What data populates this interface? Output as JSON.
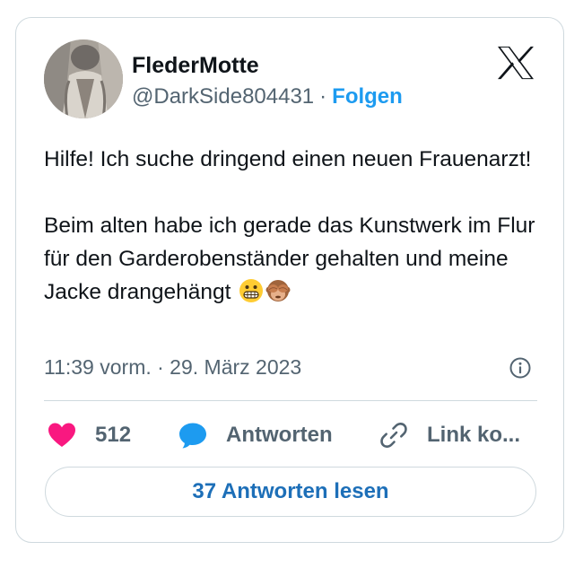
{
  "author": {
    "display_name": "FlederMotte",
    "handle": "@DarkSide804431",
    "separator": "·",
    "follow_label": "Folgen"
  },
  "tweet": {
    "text": "Hilfe! Ich suche dringend einen neuen Frauenarzt!\n\nBeim alten habe ich gerade das Kunstwerk im Flur für den Garderobenständer gehalten und meine Jacke drangehängt",
    "emojis": [
      "grimacing-face",
      "see-no-evil-monkey"
    ],
    "timestamp": "11:39 vorm. · 29. März 2023"
  },
  "actions": {
    "like_count": "512",
    "reply_label": "Antworten",
    "copy_link_label": "Link ko..."
  },
  "read_replies_label": "37 Antworten lesen",
  "colors": {
    "accent": "#1d9bf0",
    "like": "#f91880",
    "secondary_text": "#536471",
    "border": "#cfd9de"
  },
  "icons": {
    "brand": "x-logo-icon",
    "info": "info-icon",
    "like": "heart-icon",
    "reply": "speech-bubble-icon",
    "copy": "link-icon"
  }
}
